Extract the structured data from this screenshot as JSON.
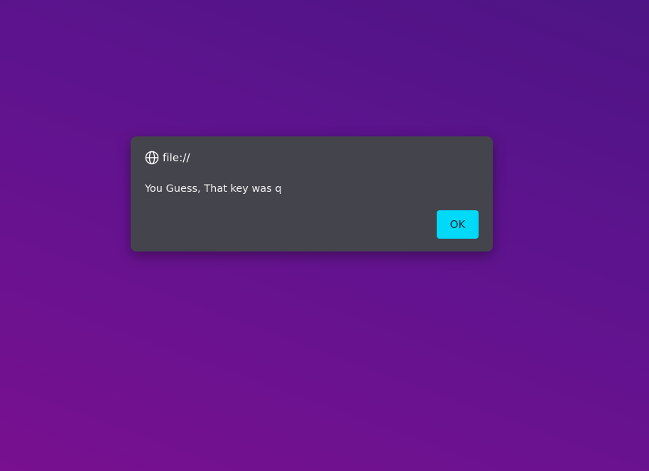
{
  "dialog": {
    "origin": "file://",
    "message": "You Guess, That key was q",
    "ok_label": "OK",
    "icon": "globe-icon"
  },
  "colors": {
    "background_top": "#4d1585",
    "background_bottom": "#78108f",
    "dialog_bg": "#44444c",
    "accent": "#00d9f7"
  }
}
